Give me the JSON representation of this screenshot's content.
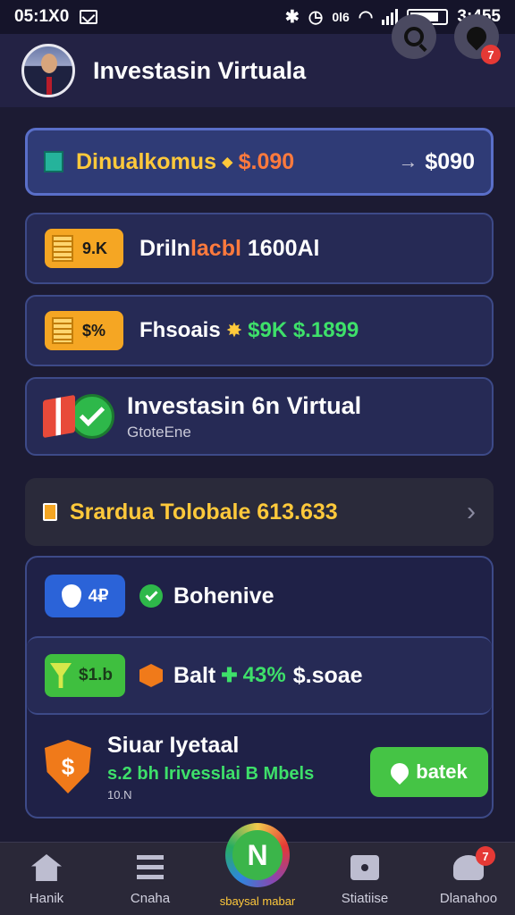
{
  "status": {
    "time": "05:1X0",
    "signal_text": "0l6",
    "battery_time": "3:455"
  },
  "header": {
    "title": "Investasin Virtuala",
    "notification_count": "7"
  },
  "row1": {
    "label": "Dinualkomus",
    "separator": "⬥",
    "value": "$.090",
    "arrow": "→",
    "right_value": "$090"
  },
  "row2": {
    "badge": "9.K",
    "label_part1": "Driln",
    "label_part2": "lacbl",
    "label_part3": "1600Al"
  },
  "row3": {
    "badge": "$%",
    "label": "Fhsoais",
    "icon": "✸",
    "green_text": "$9K $.1899"
  },
  "row4": {
    "title": "Investasin 6n Virtual",
    "subtitle": "GtoteEne"
  },
  "row5": {
    "label": "Srardua Tolobale 613.633",
    "chevron": "›"
  },
  "list": {
    "item1": {
      "pill_text": "4₽",
      "label": "Bohenive"
    },
    "item2": {
      "pill_text": "$1.b",
      "label": "Balt",
      "plus": "✚",
      "green_text": "43%",
      "value": "$.soae"
    },
    "item3": {
      "shield_text": "$",
      "title": "Siuar Iyetaal",
      "subtitle": "s.2  bh Irivesslai B Mbels",
      "small_text": "10.N",
      "button_label": "batek"
    }
  },
  "nav": {
    "items": [
      {
        "label": "Hanik",
        "icon": "home-icon"
      },
      {
        "label": "Cnaha",
        "icon": "menu-icon"
      },
      {
        "label": "sbaysal mabar",
        "icon": "fab-icon",
        "symbol": "N"
      },
      {
        "label": "Stiatiise",
        "icon": "lock-icon"
      },
      {
        "label": "Dlanahoo",
        "icon": "people-icon"
      }
    ],
    "badge": "7"
  },
  "colors": {
    "background": "#1c1b33",
    "accent_yellow": "#ffc93b",
    "accent_orange": "#ff7a3d",
    "accent_green": "#3ee06a",
    "card_blue": "#262a55"
  }
}
